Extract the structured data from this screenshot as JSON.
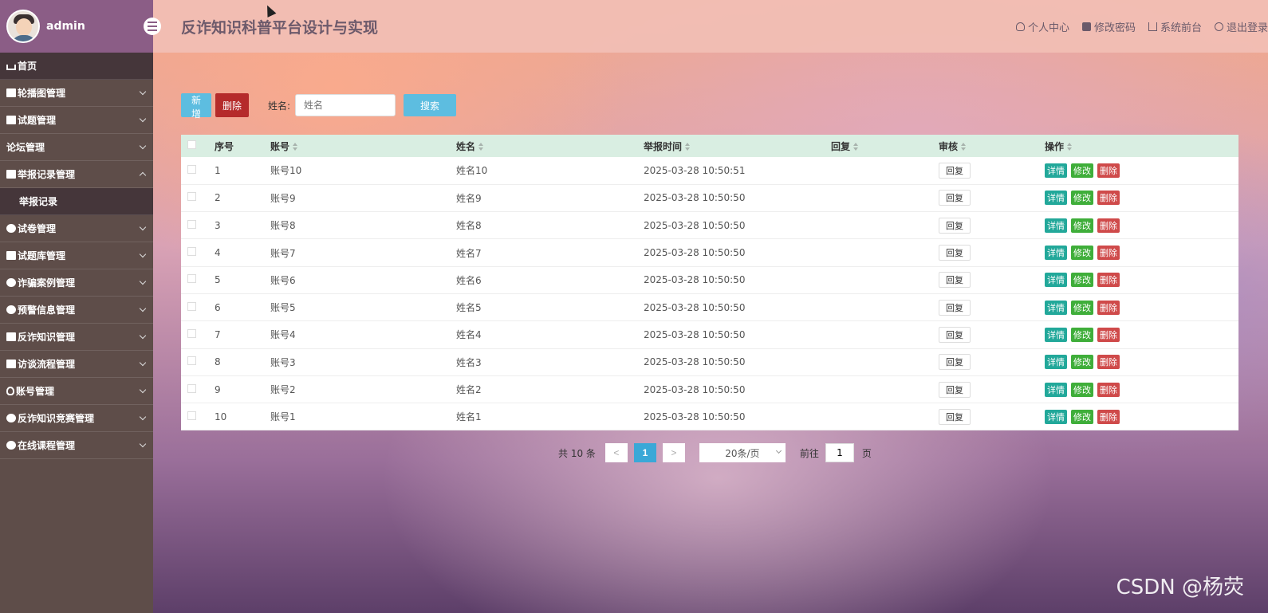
{
  "sidebar": {
    "username": "admin",
    "items": [
      {
        "label": "首页",
        "icon": "home-icon",
        "expandable": false
      },
      {
        "label": "轮播图管理",
        "icon": "square-icon",
        "expandable": true
      },
      {
        "label": "试题管理",
        "icon": "square-icon",
        "expandable": true
      },
      {
        "label": "论坛管理",
        "icon": "none",
        "expandable": true
      },
      {
        "label": "举报记录管理",
        "icon": "square-icon",
        "expandable": true,
        "expanded": true
      },
      {
        "label": "试卷管理",
        "icon": "circle-icon",
        "expandable": true
      },
      {
        "label": "试题库管理",
        "icon": "square-icon",
        "expandable": true
      },
      {
        "label": "诈骗案例管理",
        "icon": "circle-icon",
        "expandable": true
      },
      {
        "label": "预警信息管理",
        "icon": "circle-icon",
        "expandable": true
      },
      {
        "label": "反诈知识管理",
        "icon": "square-icon",
        "expandable": true
      },
      {
        "label": "访谈流程管理",
        "icon": "square-icon",
        "expandable": true
      },
      {
        "label": "账号管理",
        "icon": "person-icon",
        "expandable": true
      },
      {
        "label": "反诈知识竞赛管理",
        "icon": "circle-icon",
        "expandable": true
      },
      {
        "label": "在线课程管理",
        "icon": "circle-icon",
        "expandable": true
      }
    ],
    "sub_item": "举报记录"
  },
  "header": {
    "title": "反诈知识科普平台设计与实现",
    "links": [
      {
        "label": "个人中心",
        "icon": "user-icon"
      },
      {
        "label": "修改密码",
        "icon": "lock-icon"
      },
      {
        "label": "系统前台",
        "icon": "home-icon"
      },
      {
        "label": "退出登录",
        "icon": "close-circle-icon"
      }
    ]
  },
  "toolbar": {
    "add_label": "新增",
    "delete_label": "删除",
    "search_label": "姓名:",
    "search_placeholder": "姓名",
    "search_button": "搜索"
  },
  "table": {
    "columns": [
      "序号",
      "账号",
      "姓名",
      "举报时间",
      "回复",
      "审核",
      "操作"
    ],
    "reply_button": "回复",
    "actions": {
      "detail": "详情",
      "edit": "修改",
      "delete": "删除"
    },
    "rows": [
      {
        "index": "1",
        "account": "账号10",
        "name": "姓名10",
        "time": "2025-03-28 10:50:51"
      },
      {
        "index": "2",
        "account": "账号9",
        "name": "姓名9",
        "time": "2025-03-28 10:50:50"
      },
      {
        "index": "3",
        "account": "账号8",
        "name": "姓名8",
        "time": "2025-03-28 10:50:50"
      },
      {
        "index": "4",
        "account": "账号7",
        "name": "姓名7",
        "time": "2025-03-28 10:50:50"
      },
      {
        "index": "5",
        "account": "账号6",
        "name": "姓名6",
        "time": "2025-03-28 10:50:50"
      },
      {
        "index": "6",
        "account": "账号5",
        "name": "姓名5",
        "time": "2025-03-28 10:50:50"
      },
      {
        "index": "7",
        "account": "账号4",
        "name": "姓名4",
        "time": "2025-03-28 10:50:50"
      },
      {
        "index": "8",
        "account": "账号3",
        "name": "姓名3",
        "time": "2025-03-28 10:50:50"
      },
      {
        "index": "9",
        "account": "账号2",
        "name": "姓名2",
        "time": "2025-03-28 10:50:50"
      },
      {
        "index": "10",
        "account": "账号1",
        "name": "姓名1",
        "time": "2025-03-28 10:50:50"
      }
    ]
  },
  "pagination": {
    "total": "共 10 条",
    "prev": "<",
    "current": "1",
    "next": ">",
    "page_size": "20条/页",
    "goto_label": "前往",
    "goto_value": "1",
    "page_unit": "页"
  },
  "watermark": "CSDN @杨荧",
  "colors": {
    "sidebar_bg": "#5e4d49",
    "user_box": "#8b5d86",
    "accent_blue": "#5dbde0",
    "danger": "#b52b2b",
    "detail": "#22a89a",
    "edit": "#3fae3a",
    "delete": "#cf4a4a"
  }
}
